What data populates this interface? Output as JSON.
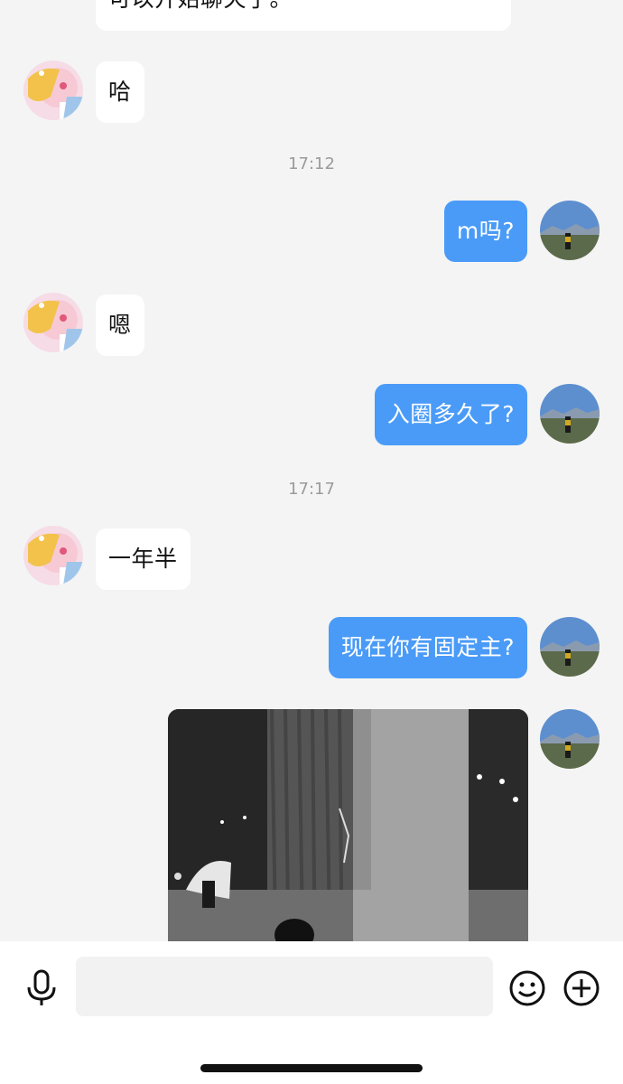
{
  "messages": [
    {
      "side": "in",
      "text": "可以开始聊天了。"
    },
    {
      "side": "in",
      "text": "哈"
    },
    {
      "side": "time",
      "text": "17:12"
    },
    {
      "side": "out",
      "text": "m吗?"
    },
    {
      "side": "in",
      "text": "嗯"
    },
    {
      "side": "out",
      "text": "入圈多久了?"
    },
    {
      "side": "time",
      "text": "17:17"
    },
    {
      "side": "in",
      "text": "一年半"
    },
    {
      "side": "out",
      "text": "现在你有固定主?"
    }
  ],
  "composer": {
    "placeholder": "",
    "mic_icon": "microphone-icon",
    "emoji_icon": "smiley-icon",
    "plus_icon": "plus-circle-icon"
  },
  "colors": {
    "background": "#f4f4f4",
    "incoming_bubble": "#ffffff",
    "outgoing_bubble": "#4a9bf7",
    "timestamp": "#9a9a9a"
  }
}
